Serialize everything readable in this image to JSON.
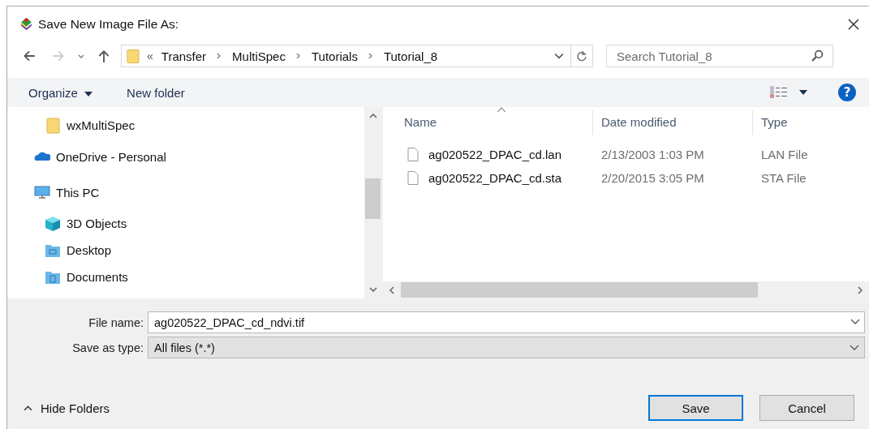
{
  "window": {
    "title": "Save New Image File As:"
  },
  "address": {
    "overflow": "«",
    "crumbs": [
      "Transfer",
      "MultiSpec",
      "Tutorials",
      "Tutorial_8"
    ]
  },
  "search": {
    "placeholder": "Search Tutorial_8"
  },
  "toolbar": {
    "organize": "Organize",
    "new_folder": "New folder",
    "help": "?"
  },
  "sidebar": {
    "items": [
      {
        "label": "wxMultiSpec",
        "kind": "folder"
      },
      {
        "label": "OneDrive - Personal",
        "kind": "cloud"
      },
      {
        "label": "This PC",
        "kind": "pc",
        "children": [
          {
            "label": "3D Objects",
            "kind": "cube"
          },
          {
            "label": "Desktop",
            "kind": "desktop"
          },
          {
            "label": "Documents",
            "kind": "documents"
          }
        ]
      }
    ]
  },
  "table": {
    "columns": [
      "Name",
      "Date modified",
      "Type"
    ],
    "rows": [
      {
        "name": "ag020522_DPAC_cd.lan",
        "date": "2/13/2003 1:03 PM",
        "type": "LAN File"
      },
      {
        "name": "ag020522_DPAC_cd.sta",
        "date": "2/20/2015 3:05 PM",
        "type": "STA File"
      }
    ]
  },
  "file_name": {
    "label": "File name:",
    "value": "ag020522_DPAC_cd_ndvi.tif"
  },
  "save_type": {
    "label": "Save as type:",
    "value": "All files (*.*)"
  },
  "hide_folders": "Hide Folders",
  "buttons": [
    {
      "label": "Save",
      "default": true
    },
    {
      "label": "Cancel",
      "default": false
    }
  ]
}
